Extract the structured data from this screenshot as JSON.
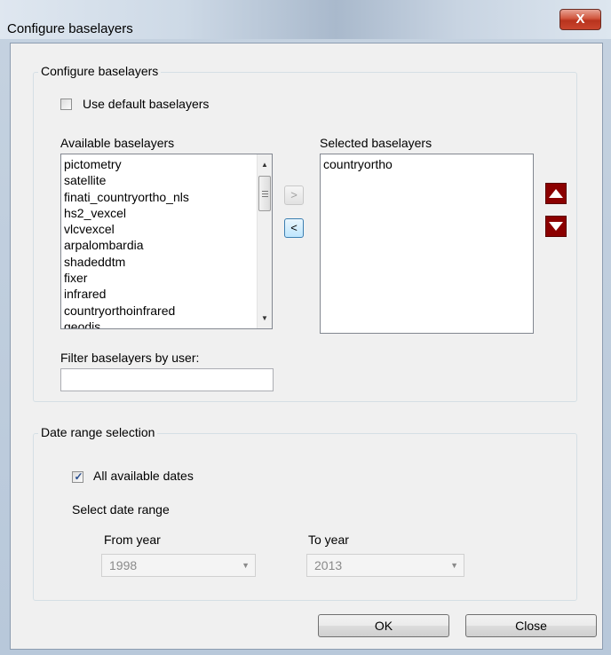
{
  "window": {
    "title": "Configure baselayers",
    "close_glyph": "X"
  },
  "baselayers_group": {
    "legend": "Configure baselayers",
    "use_default_label": "Use default baselayers",
    "use_default_checked": false,
    "available_label": "Available baselayers",
    "available_items": [
      "pictometry",
      "satellite",
      "finati_countryortho_nls",
      "hs2_vexcel",
      "vlcvexcel",
      "arpalombardia",
      "shadeddtm",
      "fixer",
      "infrared",
      "countryorthoinfrared",
      "geodis"
    ],
    "selected_label": "Selected baselayers",
    "selected_items": [
      "countryortho"
    ],
    "add_button": ">",
    "remove_button": "<",
    "filter_label": "Filter baselayers by user:",
    "filter_value": ""
  },
  "date_group": {
    "legend": "Date range selection",
    "all_dates_label": "All available dates",
    "all_dates_checked": true,
    "select_range_label": "Select date range",
    "from_label": "From year",
    "from_value": "1998",
    "to_label": "To year",
    "to_value": "2013"
  },
  "buttons": {
    "ok": "OK",
    "close": "Close"
  },
  "colors": {
    "move_buttons": "#8b0000"
  }
}
